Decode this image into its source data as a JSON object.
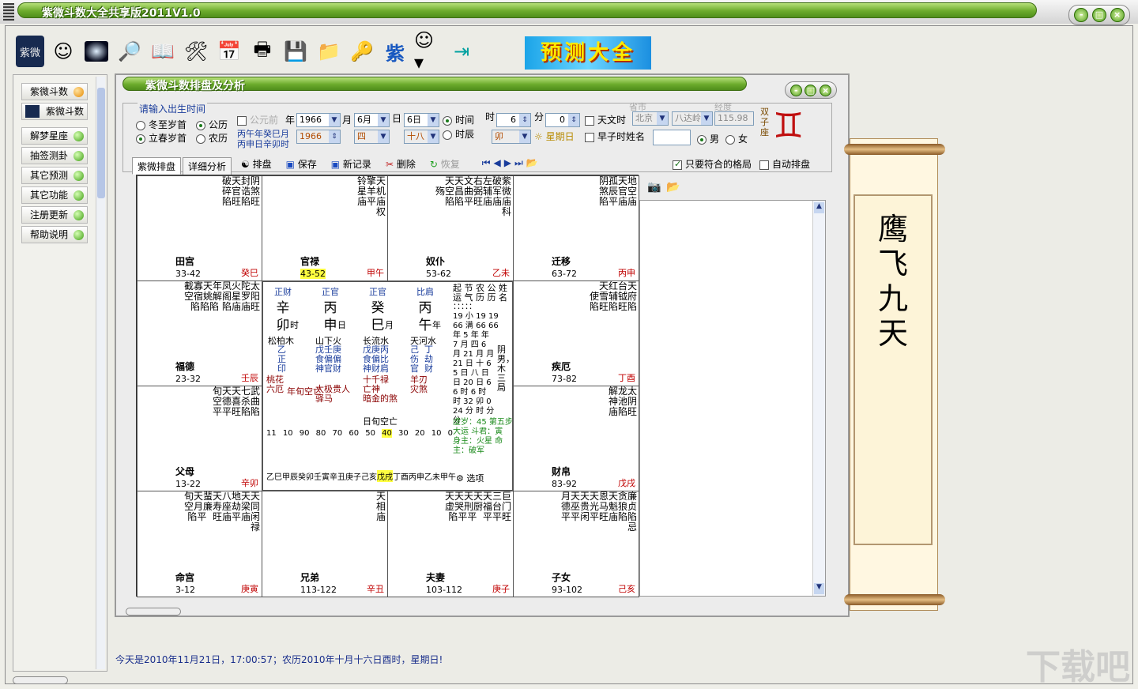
{
  "app": {
    "title": "紫微斗数大全共享版2011V1.0",
    "win_buttons": [
      "-",
      "□",
      "×"
    ]
  },
  "toolbar": {
    "icons": [
      "ziwei-logo",
      "user-icon",
      "planet-icon",
      "search-icon",
      "book-icon",
      "tools-icon",
      "calendar-icon",
      "printer-icon",
      "save-icon",
      "folder-icon",
      "key-icon",
      "zi-icon",
      "smile-icon",
      "exit-icon"
    ],
    "zi_label": "紫",
    "logo_label": "紫微",
    "banner": "预测大全"
  },
  "sidebar": {
    "items": [
      {
        "label": "紫微斗数",
        "status": "orange"
      },
      {
        "label": "紫微斗数",
        "status": "none"
      },
      {
        "label": "解梦星座",
        "status": "green"
      },
      {
        "label": "抽签测卦",
        "status": "green"
      },
      {
        "label": "其它预测",
        "status": "green"
      },
      {
        "label": "其它功能",
        "status": "green"
      },
      {
        "label": "注册更新",
        "status": "green"
      },
      {
        "label": "帮助说明",
        "status": "green"
      }
    ],
    "thumb_logo": "紫微"
  },
  "child": {
    "title": "紫微斗数排盘及分析"
  },
  "form": {
    "group_title": "请输入出生时间",
    "r_dongzhi": "冬至岁首",
    "r_lichun": "立春岁首",
    "r_gongli": "公历",
    "r_nongli": "农历",
    "gongyuan": "公元前",
    "nian": "年",
    "yue": "月",
    "ri": "日",
    "shi": "时",
    "fen": "分",
    "year": "1966",
    "month": "6月",
    "day": "6日",
    "year2": "1966",
    "month2": "四",
    "day2": "十八",
    "ganzhi1": "丙午年癸巳月",
    "ganzhi2": "丙申日辛卯时",
    "r_shijian": "时间",
    "r_shichen": "时辰",
    "hour": "6",
    "minute": "0",
    "shichen": "卯",
    "weekday": "星期日",
    "tianwenshi": "天文时",
    "zaozishi": "早子时",
    "name_label": "姓名",
    "province_label": "省市",
    "province": "北京",
    "city": "八达岭",
    "lon_label": "经度",
    "lon": "115.98",
    "male": "男",
    "female": "女",
    "zodiac": "双子座"
  },
  "tabs": {
    "paipan": "紫微排盘",
    "fenxi": "详细分析",
    "items": [
      "排盘",
      "保存",
      "新记录",
      "删除",
      "恢复"
    ],
    "only_match": "只要符合的格局",
    "auto": "自动排盘"
  },
  "palaces": [
    {
      "name": "田宫",
      "range": "33-42",
      "gz": "癸巳",
      "stars": "破天封阴\n碎官诰煞\n陷旺陷旺"
    },
    {
      "name": "官禄",
      "range": "43-52",
      "gz": "甲午",
      "stars": "铃擎天\n星羊机\n庙平庙\n权"
    },
    {
      "name": "奴仆",
      "range": "53-62",
      "gz": "乙未",
      "stars": "天天文右左破紫\n殇空昌曲弼辅军微\n陷陷平旺庙庙庙\n科"
    },
    {
      "name": "迁移",
      "range": "63-72",
      "gz": "丙申",
      "stars": "阴孤天地\n煞辰官空\n陷平庙庙"
    },
    {
      "name": "福德",
      "range": "23-32",
      "gz": "壬辰",
      "stars": "截寡天年凤火陀太\n空宿姚解阁星罗阳\n陷陷陷 陷庙庙旺"
    },
    {
      "name": "疾厄",
      "range": "73-82",
      "gz": "丁酉",
      "stars": "天红台天\n使雪辅钺府\n陷旺陷旺陷"
    },
    {
      "name": "父母",
      "range": "13-22",
      "gz": "辛卯",
      "stars": "旬天天七武\n空德喜杀曲\n平平旺陷陷"
    },
    {
      "name": "财帛",
      "range": "83-92",
      "gz": "戊戌",
      "stars": "解龙太\n神池阴\n庙陷旺"
    },
    {
      "name": "命宫",
      "range": "3-12",
      "gz": "庚寅",
      "stars": "旬天蜚天八地天天\n空月廉寿座劫梁同\n陷平  旺庙平庙闲\n禄"
    },
    {
      "name": "兄弟",
      "range": "113-122",
      "gz": "辛丑",
      "stars": "天\n相\n庙"
    },
    {
      "name": "夫妻",
      "range": "103-112",
      "gz": "庚子",
      "stars": "天天天天天三巨\n虚哭刑厨福台门\n陷平平  平平旺"
    },
    {
      "name": "子女",
      "range": "93-102",
      "gz": "己亥",
      "stars": "月天天天恩天贪廉\n德巫贵光马魁狼贞\n平平闲平旺庙陷陷\n忌"
    }
  ],
  "center": {
    "shishen": [
      "正财",
      "正官",
      "正官",
      "比肩"
    ],
    "gan": [
      "辛",
      "丙",
      "癸",
      "丙"
    ],
    "zhi": [
      "卯",
      "申",
      "巳",
      "午"
    ],
    "pillar_labels": [
      "时",
      "日",
      "月",
      "年"
    ],
    "nayin": [
      "松柏木",
      "山下火",
      "长流水",
      "天河水"
    ],
    "canggan": [
      "乙\n正\n印",
      "戊壬庚\n食偏偏\n神官财",
      "戊庚丙\n食偏比\n神财肩",
      "己  丁\n伤  劫\n官  财"
    ],
    "shensha": [
      "桃花\n六厄",
      "年旬空亡",
      "太极贵人\n驿马",
      "十千禄\n亡神\n暗金的煞",
      "羊刃\n灾煞"
    ],
    "kongwang": "日旬空亡",
    "info_head": "起 节 农 公 姓\n运 气 历 历 名",
    "info_body": "：：：：：\n19 小 19 19\n66 满 66 66\n年 5 年 年\n7 月 四 6\n月 21 月 月\n21 日 十 6\n5 日 八 日\n日 20 日 6\n6 时 6 时\n时 32 卯 0\n24 分 时 分\n分",
    "info_tail": "阴男，木三局",
    "dayun_age": [
      "11",
      "10",
      "90",
      "80",
      "70",
      "60",
      "50",
      "40",
      "30",
      "20",
      "10",
      "0"
    ],
    "dayun_gz": [
      "乙巳",
      "甲辰",
      "癸卯",
      "壬寅",
      "辛丑",
      "庚子",
      "己亥",
      "戊戌",
      "丁酉",
      "丙申",
      "乙未",
      "甲午"
    ],
    "zhu": "虚岁：45 第五步大运 斗君：寅 身主：火星 命主：破军",
    "options": "选项"
  },
  "status": "今天是2010年11月21日，17:00:57；农历2010年十月十六日酉时，星期日!",
  "scroll_text": "鹰飞九天",
  "watermark": "下载吧"
}
